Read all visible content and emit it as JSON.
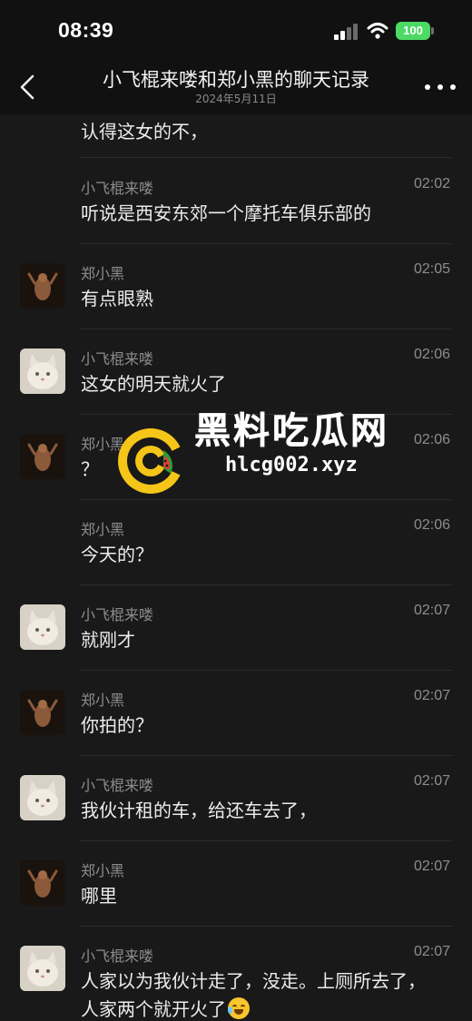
{
  "status_bar": {
    "time": "08:39",
    "battery": "100",
    "signal_icon": "cellular-signal-icon",
    "wifi_icon": "wifi-icon",
    "battery_color": "#4cd964"
  },
  "nav": {
    "title": "小飞棍来喽和郑小黑的聊天记录",
    "subtitle": "2024年5月11日",
    "back_icon": "chevron-left-icon",
    "more_icon": "more-dots-icon"
  },
  "top_fragment": {
    "text": "认得这女的不，"
  },
  "messages": [
    {
      "sender": "小飞棍来喽",
      "time": "02:02",
      "text": "听说是西安东郊一个摩托车俱乐部的",
      "avatar": "none"
    },
    {
      "sender": "郑小黑",
      "time": "02:05",
      "text": "有点眼熟",
      "avatar": "dark-figure-avatar"
    },
    {
      "sender": "小飞棍来喽",
      "time": "02:06",
      "text": "这女的明天就火了",
      "avatar": "cat-avatar"
    },
    {
      "sender": "郑小黑",
      "time": "02:06",
      "text": "？",
      "avatar": "dark-figure-avatar"
    },
    {
      "sender": "郑小黑",
      "time": "02:06",
      "text": "今天的？",
      "avatar": "none"
    },
    {
      "sender": "小飞棍来喽",
      "time": "02:07",
      "text": "就刚才",
      "avatar": "cat-avatar"
    },
    {
      "sender": "郑小黑",
      "time": "02:07",
      "text": "你拍的？",
      "avatar": "dark-figure-avatar"
    },
    {
      "sender": "小飞棍来喽",
      "time": "02:07",
      "text": "我伙计租的车，给还车去了，",
      "avatar": "cat-avatar"
    },
    {
      "sender": "郑小黑",
      "time": "02:07",
      "text": "哪里",
      "avatar": "dark-figure-avatar"
    },
    {
      "sender": "小飞棍来喽",
      "time": "02:07",
      "text": "人家以为我伙计走了，没走。上厕所去了，人家两个就开火了",
      "avatar": "cat-avatar",
      "emoji": "laughing-crying-emoji-icon"
    }
  ],
  "watermark": {
    "title": "黑料吃瓜网",
    "url": "hlcg002.xyz",
    "logo_icon": "watermelon-logo-icon",
    "logo_colors": [
      "#f5c518",
      "#2a9d3a",
      "#e53935"
    ]
  },
  "colors": {
    "background": "#191919",
    "header": "#111111",
    "secondary_text": "#8d8d8d",
    "primary_text": "#ececec"
  }
}
